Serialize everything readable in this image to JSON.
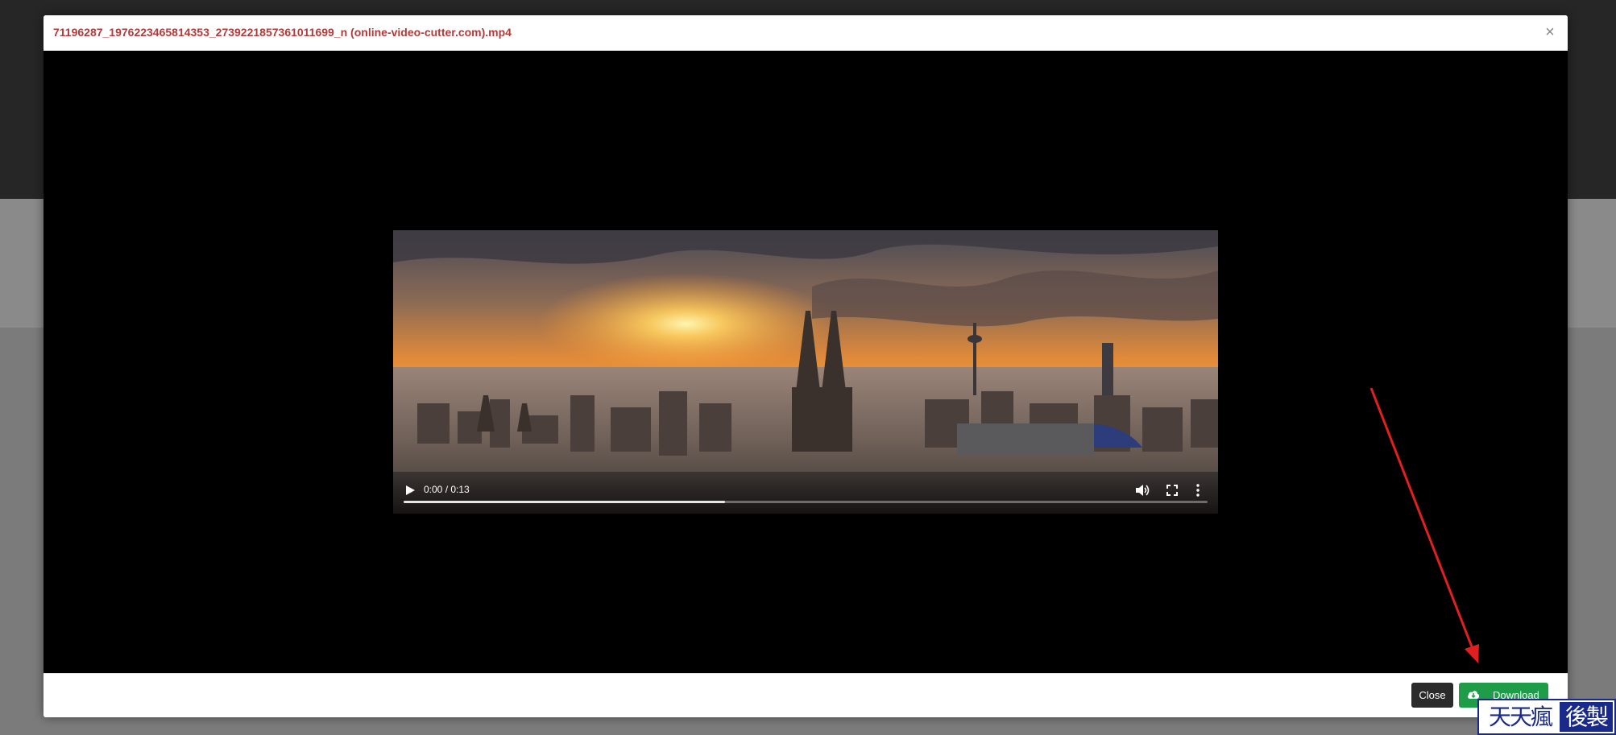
{
  "modal": {
    "title": "71196287_1976223465814353_2739221857361011699_n (online-video-cutter.com).mp4",
    "close_symbol": "×"
  },
  "video": {
    "time_display": "0:00 / 0:13",
    "progress_buffered": 0.4,
    "icons": {
      "play": "play-icon",
      "volume": "volume-icon",
      "fullscreen": "fullscreen-icon",
      "more": "more-options-icon"
    }
  },
  "footer": {
    "close_label": "Close",
    "download_label": "Download",
    "download_icon": "cloud-download-icon"
  },
  "annotation": {
    "arrow_color": "#e02020"
  },
  "watermark": {
    "left_text": "天天瘋",
    "right_text": "後製"
  },
  "colors": {
    "title": "#b33a3a",
    "download_button": "#1e9c47",
    "close_button": "#2b2b2b"
  }
}
